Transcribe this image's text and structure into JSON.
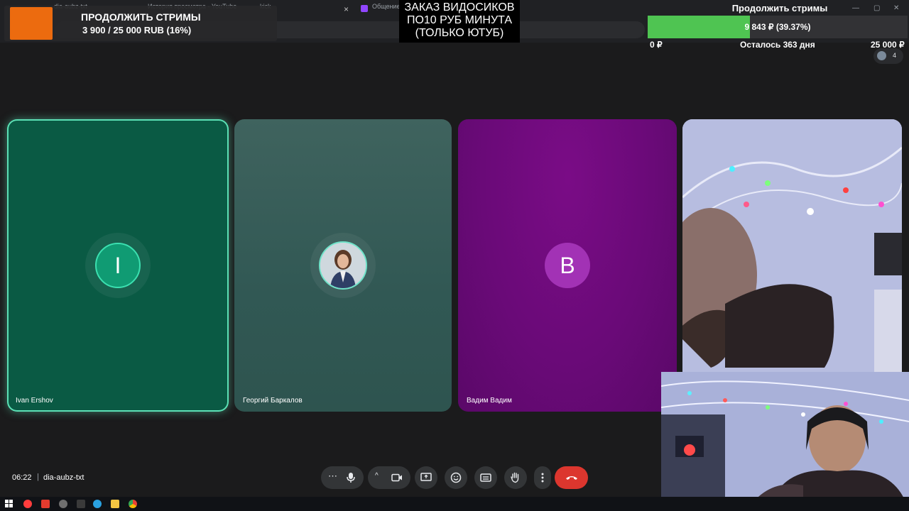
{
  "browser": {
    "tabs": [
      {
        "label": "dia-aubz-txt"
      },
      {
        "label": "История просмотра - YouTube"
      },
      {
        "label": "kick"
      },
      {
        "label": "Общение"
      }
    ],
    "close_glyph": "×"
  },
  "overlay": {
    "donation": {
      "title": "ПРОДОЛЖИТЬ СТРИМЫ",
      "amount": "3 900 / 25 000 RUB (16%)",
      "accent_color": "#ec6b0f"
    },
    "order_banner": {
      "line1": "ЗАКАЗ ВИДОСИКОВ",
      "line2": "ПО10 РУБ МИНУТА",
      "line3": "(ТОЛЬКО ЮТУБ)"
    },
    "goal": {
      "title": "Продолжить стримы",
      "progress_text": "9 843 ₽ (39.37%)",
      "progress_fraction": 0.3937,
      "min_label": "0 ₽",
      "remaining_label": "Осталось 363 дня",
      "max_label": "25 000 ₽",
      "fill_color": "#4fc452"
    }
  },
  "meet": {
    "participant_count": "4",
    "tiles": [
      {
        "name": "Ivan Ershov",
        "avatar_letter": "I",
        "speaking": true
      },
      {
        "name": "Георгий Баркалов",
        "avatar_icon": "profile-photo"
      },
      {
        "name": "Вадим Вадим",
        "avatar_letter": "В"
      },
      {
        "name": "",
        "video": "camera-feed"
      }
    ],
    "footer": {
      "time": "06:22",
      "separator": "|",
      "meeting_code": "dia-aubz-txt"
    },
    "controls": [
      {
        "icon": "more-options-icon"
      },
      {
        "icon": "microphone-icon"
      },
      {
        "icon": "chevron-up-icon"
      },
      {
        "icon": "camera-icon"
      },
      {
        "icon": "present-screen-icon"
      },
      {
        "icon": "emoji-icon"
      },
      {
        "icon": "captions-icon"
      },
      {
        "icon": "raise-hand-icon"
      },
      {
        "icon": "more-vertical-icon"
      },
      {
        "icon": "end-call-icon"
      }
    ],
    "colors": {
      "tile1": "#0a5a44",
      "tile2": "#3f635e",
      "tile3": "#6a0a78",
      "end_call": "#dc362e"
    }
  }
}
